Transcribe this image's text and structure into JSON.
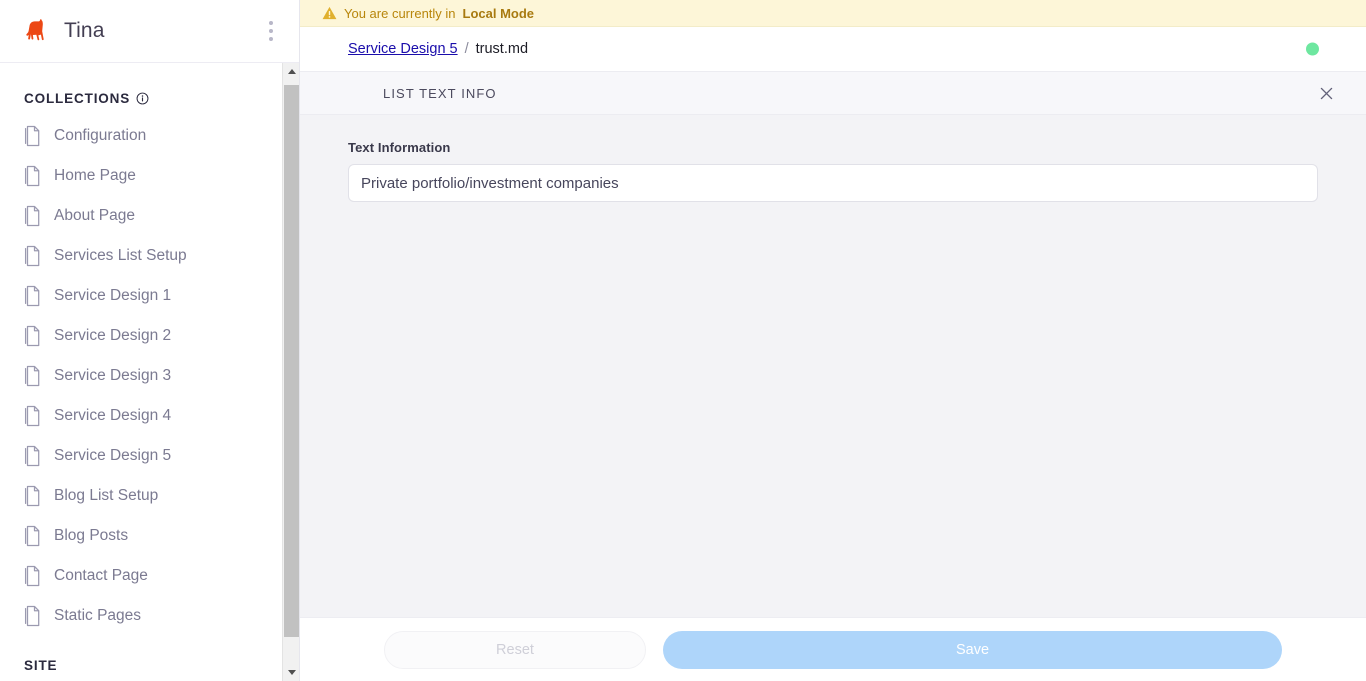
{
  "sidebar": {
    "brand": "Tina",
    "logo_icon": "llama-logo-icon",
    "menu_icon": "kebab-menu-icon",
    "brand_color": "#EC4815",
    "sections": [
      {
        "title": "COLLECTIONS",
        "info_icon": "info-circle-icon",
        "items": [
          {
            "label": "Configuration",
            "icon": "document-icon"
          },
          {
            "label": "Home Page",
            "icon": "document-icon"
          },
          {
            "label": "About Page",
            "icon": "document-icon"
          },
          {
            "label": "Services List Setup",
            "icon": "document-icon"
          },
          {
            "label": "Service Design 1",
            "icon": "document-icon"
          },
          {
            "label": "Service Design 2",
            "icon": "document-icon"
          },
          {
            "label": "Service Design 3",
            "icon": "document-icon"
          },
          {
            "label": "Service Design 4",
            "icon": "document-icon"
          },
          {
            "label": "Service Design 5",
            "icon": "document-icon"
          },
          {
            "label": "Blog List Setup",
            "icon": "document-icon"
          },
          {
            "label": "Blog Posts",
            "icon": "document-icon"
          },
          {
            "label": "Contact Page",
            "icon": "document-icon"
          },
          {
            "label": "Static Pages",
            "icon": "document-icon"
          }
        ]
      },
      {
        "title": "SITE",
        "items": []
      }
    ],
    "scrollbar": {
      "up_icon": "scroll-up-arrow-icon",
      "down_icon": "scroll-down-arrow-icon"
    }
  },
  "banner": {
    "icon": "warning-triangle-icon",
    "text_prefix": "You are currently in ",
    "mode": "Local Mode",
    "background": "#FDF6D8",
    "text_color": "#B8860B"
  },
  "breadcrumb": {
    "parent": "Service Design 5",
    "separator": "/",
    "current": "trust.md",
    "link_color": "#1A0DAB"
  },
  "status": {
    "indicator": "sync-status-dot",
    "color": "#6EE7A0"
  },
  "form": {
    "title": "LIST TEXT INFO",
    "close_icon": "close-x-icon",
    "fields": [
      {
        "label": "Text Information",
        "value": "Private portfolio/investment companies",
        "placeholder": ""
      }
    ],
    "footer": {
      "reset_label": "Reset",
      "save_label": "Save",
      "save_color": "#AED5FA"
    }
  }
}
